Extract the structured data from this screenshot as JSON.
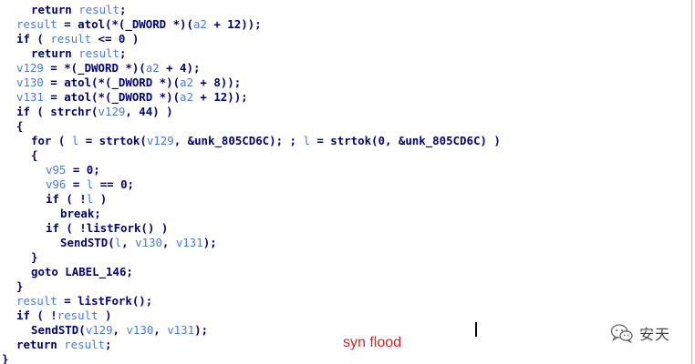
{
  "code": {
    "lines": [
      {
        "indent": 2,
        "parts": [
          {
            "t": "return ",
            "c": "kw"
          },
          {
            "t": "result",
            "c": "var"
          },
          {
            "t": ";",
            "c": "kw"
          }
        ]
      },
      {
        "indent": 1,
        "parts": [
          {
            "t": "result",
            "c": "var"
          },
          {
            "t": " = atol(*(_DWORD *)(",
            "c": "kw"
          },
          {
            "t": "a2",
            "c": "var"
          },
          {
            "t": " + 12));",
            "c": "kw"
          }
        ]
      },
      {
        "indent": 1,
        "parts": [
          {
            "t": "if ( ",
            "c": "kw"
          },
          {
            "t": "result",
            "c": "var"
          },
          {
            "t": " <= 0 )",
            "c": "kw"
          }
        ]
      },
      {
        "indent": 2,
        "parts": [
          {
            "t": "return ",
            "c": "kw"
          },
          {
            "t": "result",
            "c": "var"
          },
          {
            "t": ";",
            "c": "kw"
          }
        ]
      },
      {
        "indent": 1,
        "parts": [
          {
            "t": "v129",
            "c": "var"
          },
          {
            "t": " = *(_DWORD *)(",
            "c": "kw"
          },
          {
            "t": "a2",
            "c": "var"
          },
          {
            "t": " + 4);",
            "c": "kw"
          }
        ]
      },
      {
        "indent": 1,
        "parts": [
          {
            "t": "v130",
            "c": "var"
          },
          {
            "t": " = atol(*(_DWORD *)(",
            "c": "kw"
          },
          {
            "t": "a2",
            "c": "var"
          },
          {
            "t": " + 8));",
            "c": "kw"
          }
        ]
      },
      {
        "indent": 1,
        "parts": [
          {
            "t": "v131",
            "c": "var"
          },
          {
            "t": " = atol(*(_DWORD *)(",
            "c": "kw"
          },
          {
            "t": "a2",
            "c": "var"
          },
          {
            "t": " + 12));",
            "c": "kw"
          }
        ]
      },
      {
        "indent": 1,
        "parts": [
          {
            "t": "if ( strchr(",
            "c": "kw"
          },
          {
            "t": "v129",
            "c": "var"
          },
          {
            "t": ", 44) )",
            "c": "kw"
          }
        ]
      },
      {
        "indent": 1,
        "parts": [
          {
            "t": "{",
            "c": "kw"
          }
        ]
      },
      {
        "indent": 2,
        "parts": [
          {
            "t": "for ( ",
            "c": "kw"
          },
          {
            "t": "l",
            "c": "var"
          },
          {
            "t": " = strtok(",
            "c": "kw"
          },
          {
            "t": "v129",
            "c": "var"
          },
          {
            "t": ", &unk_805CD6C); ; ",
            "c": "kw"
          },
          {
            "t": "l",
            "c": "var"
          },
          {
            "t": " = strtok(0, &unk_805CD6C) )",
            "c": "kw"
          }
        ]
      },
      {
        "indent": 2,
        "parts": [
          {
            "t": "{",
            "c": "kw"
          }
        ]
      },
      {
        "indent": 3,
        "parts": [
          {
            "t": "v95",
            "c": "var"
          },
          {
            "t": " = 0;",
            "c": "kw"
          }
        ]
      },
      {
        "indent": 3,
        "parts": [
          {
            "t": "v96",
            "c": "var"
          },
          {
            "t": " = ",
            "c": "kw"
          },
          {
            "t": "l",
            "c": "var"
          },
          {
            "t": " == 0;",
            "c": "kw"
          }
        ]
      },
      {
        "indent": 3,
        "parts": [
          {
            "t": "if ( !",
            "c": "kw"
          },
          {
            "t": "l",
            "c": "var"
          },
          {
            "t": " )",
            "c": "kw"
          }
        ]
      },
      {
        "indent": 4,
        "parts": [
          {
            "t": "break;",
            "c": "kw"
          }
        ]
      },
      {
        "indent": 3,
        "parts": [
          {
            "t": "if ( !listFork() )",
            "c": "kw"
          }
        ]
      },
      {
        "indent": 4,
        "parts": [
          {
            "t": "SendSTD(",
            "c": "kw"
          },
          {
            "t": "l",
            "c": "var"
          },
          {
            "t": ", ",
            "c": "kw"
          },
          {
            "t": "v130",
            "c": "var"
          },
          {
            "t": ", ",
            "c": "kw"
          },
          {
            "t": "v131",
            "c": "var"
          },
          {
            "t": ");",
            "c": "kw"
          }
        ]
      },
      {
        "indent": 2,
        "parts": [
          {
            "t": "}",
            "c": "kw"
          }
        ]
      },
      {
        "indent": 2,
        "parts": [
          {
            "t": "goto LABEL_146;",
            "c": "kw"
          }
        ]
      },
      {
        "indent": 1,
        "parts": [
          {
            "t": "}",
            "c": "kw"
          }
        ]
      },
      {
        "indent": 1,
        "parts": [
          {
            "t": "result",
            "c": "var"
          },
          {
            "t": " = listFork();",
            "c": "kw"
          }
        ]
      },
      {
        "indent": 1,
        "parts": [
          {
            "t": "if ( !",
            "c": "kw"
          },
          {
            "t": "result",
            "c": "var"
          },
          {
            "t": " )",
            "c": "kw"
          }
        ]
      },
      {
        "indent": 2,
        "parts": [
          {
            "t": "SendSTD(",
            "c": "kw"
          },
          {
            "t": "v129",
            "c": "var"
          },
          {
            "t": ", ",
            "c": "kw"
          },
          {
            "t": "v130",
            "c": "var"
          },
          {
            "t": ", ",
            "c": "kw"
          },
          {
            "t": "v131",
            "c": "var"
          },
          {
            "t": ");",
            "c": "kw"
          }
        ]
      },
      {
        "indent": 1,
        "parts": [
          {
            "t": "return ",
            "c": "kw"
          },
          {
            "t": "result",
            "c": "var"
          },
          {
            "t": ";",
            "c": "kw"
          }
        ]
      },
      {
        "indent": 0,
        "parts": [
          {
            "t": "}",
            "c": "kw"
          }
        ]
      }
    ]
  },
  "annotation": {
    "text": "syn flood",
    "color": "#e02020"
  },
  "watermark": {
    "icon": "wechat-icon",
    "text": "安天"
  },
  "colors": {
    "code_text": "#000080",
    "variable": "#4a7bdf",
    "background": "#ffffff"
  }
}
